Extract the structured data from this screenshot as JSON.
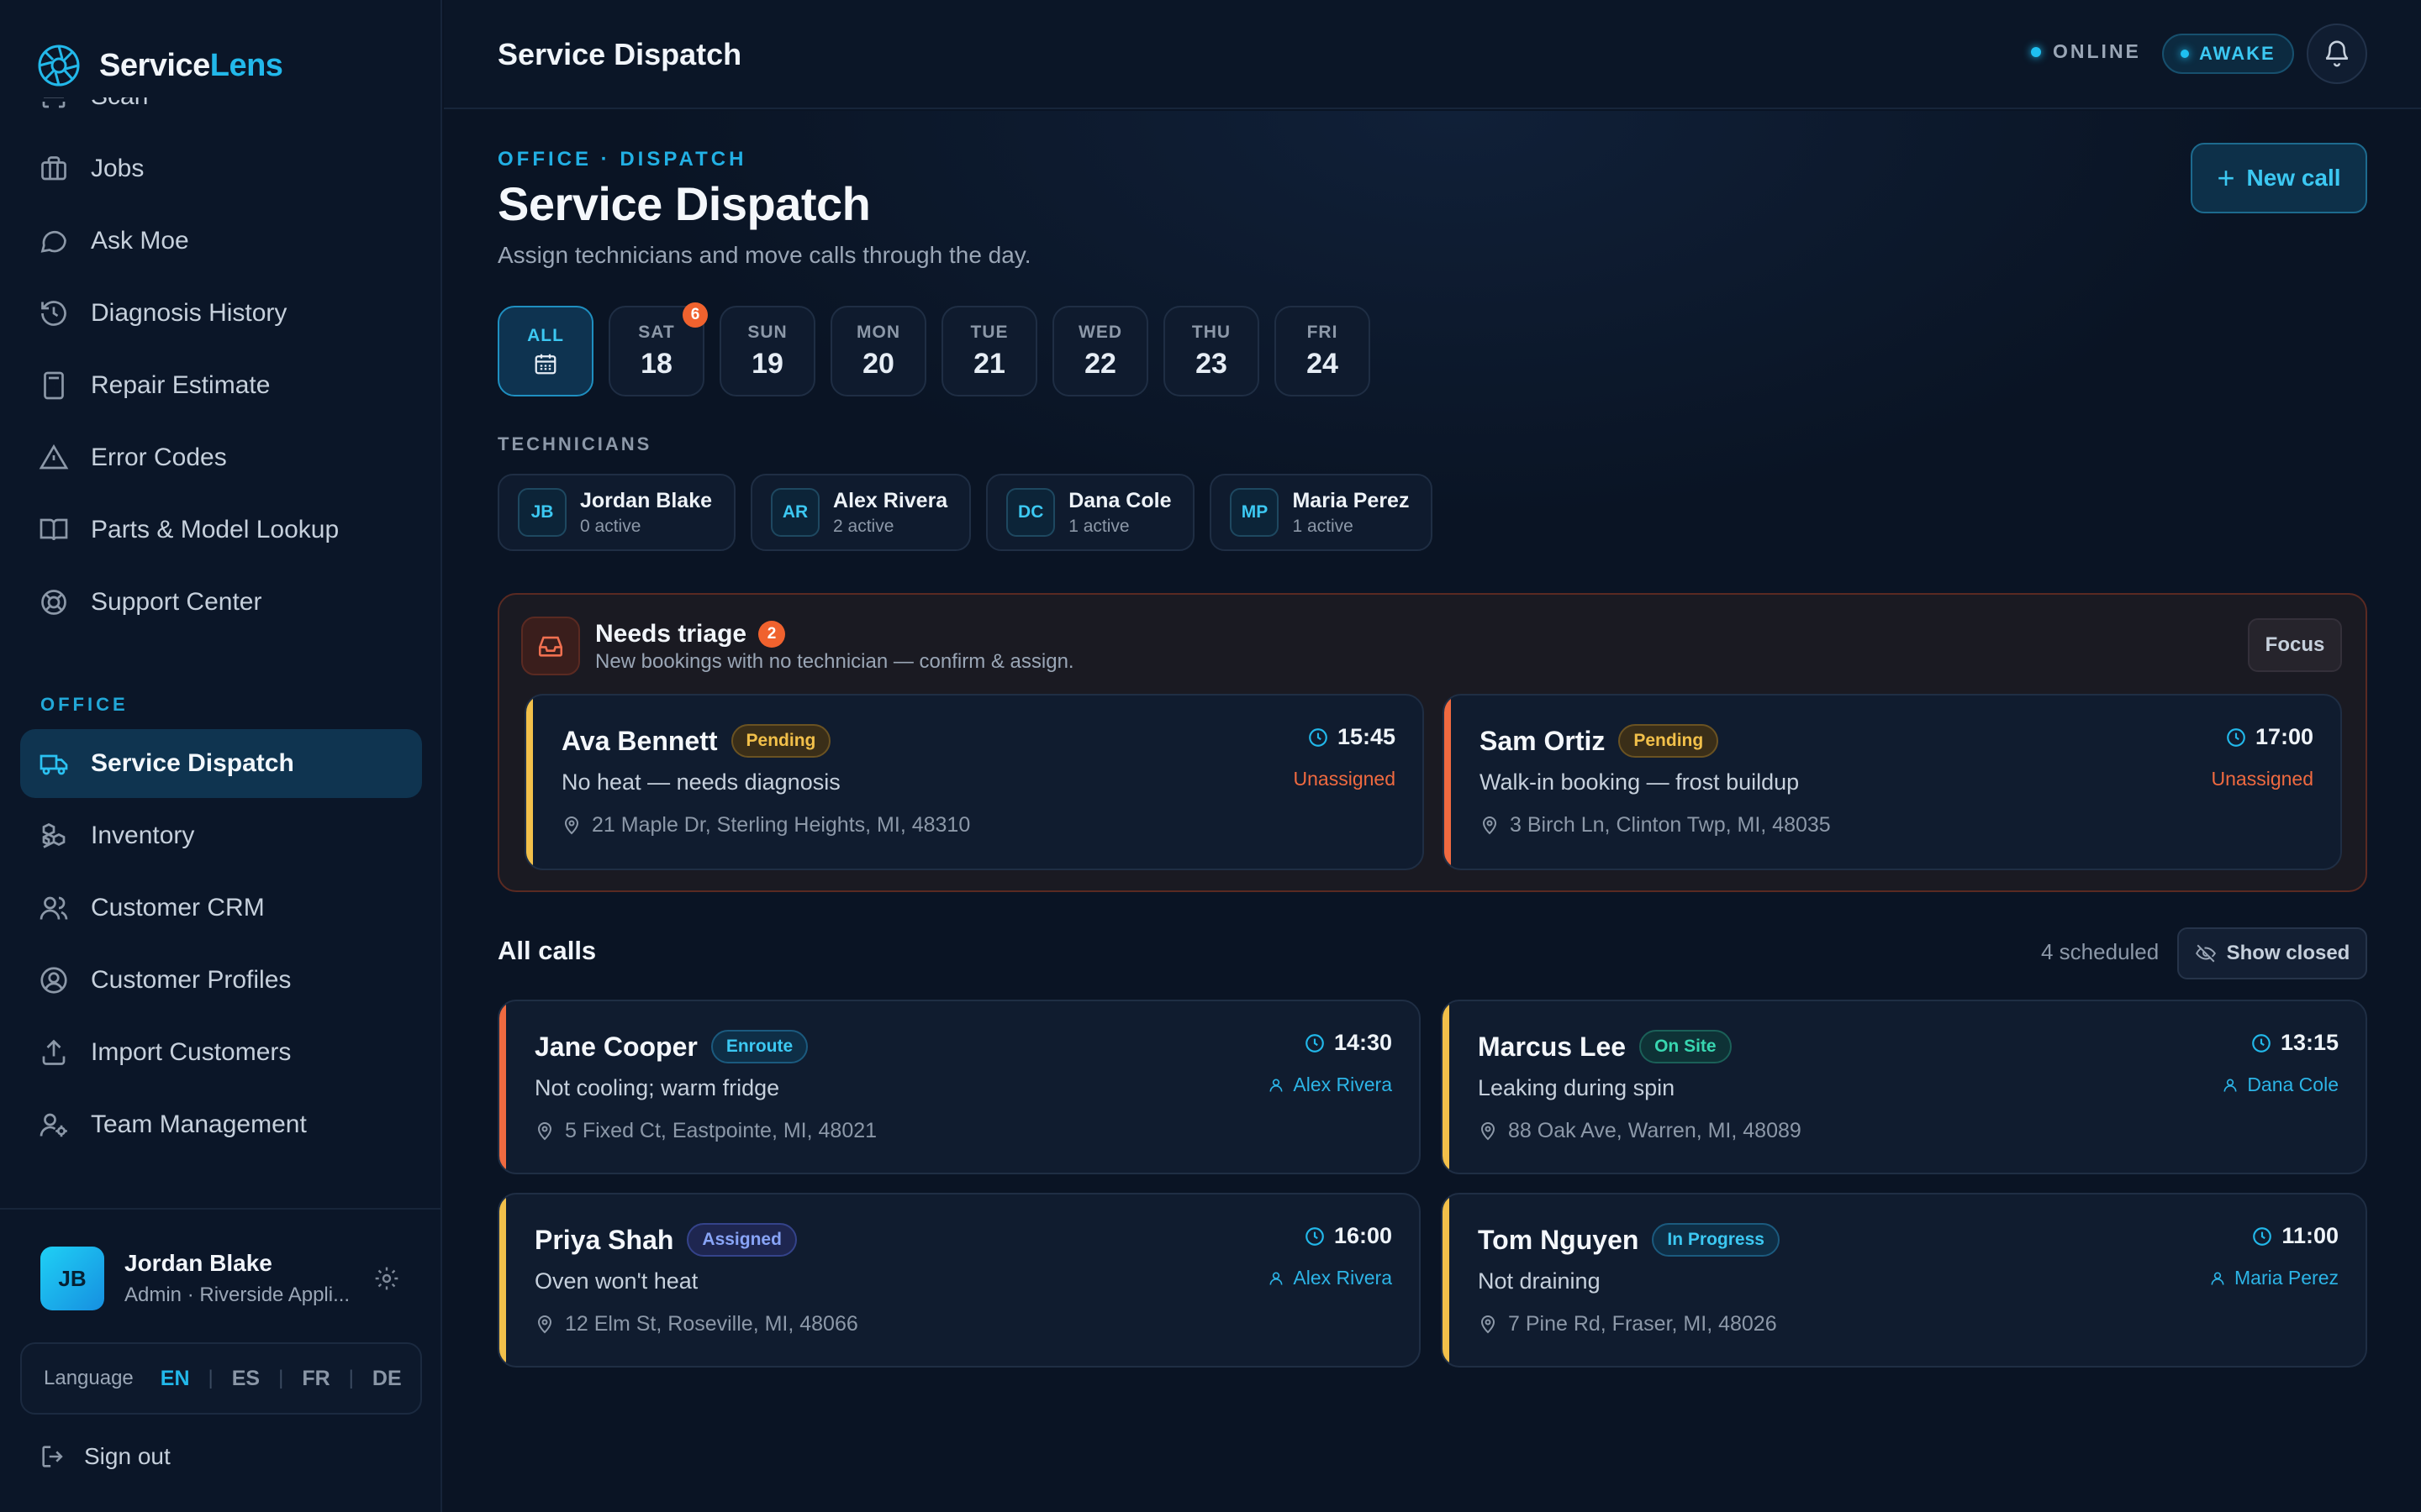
{
  "brand": {
    "name_main": "Service",
    "name_accent": "Lens"
  },
  "sidebar": {
    "items": [
      {
        "label": "Scan",
        "icon": "scan-icon"
      },
      {
        "label": "Jobs",
        "icon": "briefcase-icon"
      },
      {
        "label": "Ask Moe",
        "icon": "chat-bubble-icon"
      },
      {
        "label": "Diagnosis History",
        "icon": "history-icon"
      },
      {
        "label": "Repair Estimate",
        "icon": "calculator-icon"
      },
      {
        "label": "Error Codes",
        "icon": "warning-triangle-icon"
      },
      {
        "label": "Parts & Model Lookup",
        "icon": "open-book-icon"
      },
      {
        "label": "Support Center",
        "icon": "lifebuoy-icon"
      }
    ],
    "office_section": "OFFICE",
    "office_items": [
      {
        "label": "Service Dispatch",
        "icon": "truck-icon",
        "active": true
      },
      {
        "label": "Inventory",
        "icon": "boxes-icon"
      },
      {
        "label": "Customer CRM",
        "icon": "users-icon"
      },
      {
        "label": "Customer Profiles",
        "icon": "user-circle-icon"
      },
      {
        "label": "Import Customers",
        "icon": "upload-icon"
      },
      {
        "label": "Team Management",
        "icon": "user-gear-icon"
      }
    ],
    "user": {
      "initials": "JB",
      "name": "Jordan Blake",
      "role": "Admin · Riverside Appli..."
    },
    "language": {
      "label": "Language",
      "options": [
        "EN",
        "ES",
        "FR",
        "DE"
      ],
      "selected": "EN"
    },
    "sign_out": "Sign out"
  },
  "topbar": {
    "title": "Service Dispatch",
    "online": "ONLINE",
    "awake": "AWAKE"
  },
  "header": {
    "eyebrow": "OFFICE · DISPATCH",
    "title": "Service Dispatch",
    "subtitle": "Assign technicians and move calls through the day.",
    "new_call": "New call"
  },
  "days": {
    "all_label": "ALL",
    "items": [
      {
        "name": "SAT",
        "num": "18",
        "badge": "6"
      },
      {
        "name": "SUN",
        "num": "19"
      },
      {
        "name": "MON",
        "num": "20"
      },
      {
        "name": "TUE",
        "num": "21"
      },
      {
        "name": "WED",
        "num": "22"
      },
      {
        "name": "THU",
        "num": "23"
      },
      {
        "name": "FRI",
        "num": "24"
      }
    ]
  },
  "technicians": {
    "label": "TECHNICIANS",
    "items": [
      {
        "initials": "JB",
        "name": "Jordan Blake",
        "active": "0 active"
      },
      {
        "initials": "AR",
        "name": "Alex Rivera",
        "active": "2 active"
      },
      {
        "initials": "DC",
        "name": "Dana Cole",
        "active": "1 active"
      },
      {
        "initials": "MP",
        "name": "Maria Perez",
        "active": "1 active"
      }
    ]
  },
  "triage": {
    "title": "Needs triage",
    "count": "2",
    "subtitle": "New bookings with no technician — confirm & assign.",
    "focus": "Focus",
    "cards": [
      {
        "name": "Ava Bennett",
        "status": "Pending",
        "desc": "No heat — needs diagnosis",
        "address": "21 Maple Dr, Sterling Heights, MI, 48310",
        "time": "15:45",
        "assignee": "Unassigned",
        "bar": "#f2c04a"
      },
      {
        "name": "Sam Ortiz",
        "status": "Pending",
        "desc": "Walk-in booking — frost buildup",
        "address": "3 Birch Ln, Clinton Twp, MI, 48035",
        "time": "17:00",
        "assignee": "Unassigned",
        "bar": "#f06a40"
      }
    ]
  },
  "calls": {
    "title": "All calls",
    "scheduled": "4 scheduled",
    "show_closed": "Show closed",
    "cards": [
      {
        "name": "Jane Cooper",
        "status": "Enroute",
        "desc": "Not cooling; warm fridge",
        "address": "5 Fixed Ct, Eastpointe, MI, 48021",
        "time": "14:30",
        "assignee": "Alex Rivera",
        "bar": "#f06a40"
      },
      {
        "name": "Marcus Lee",
        "status": "On Site",
        "desc": "Leaking during spin",
        "address": "88 Oak Ave, Warren, MI, 48089",
        "time": "13:15",
        "assignee": "Dana Cole",
        "bar": "#f2c04a"
      },
      {
        "name": "Priya Shah",
        "status": "Assigned",
        "desc": "Oven won't heat",
        "address": "12 Elm St, Roseville, MI, 48066",
        "time": "16:00",
        "assignee": "Alex Rivera",
        "bar": "#f2c04a"
      },
      {
        "name": "Tom Nguyen",
        "status": "In Progress",
        "desc": "Not draining",
        "address": "7 Pine Rd, Fraser, MI, 48026",
        "time": "11:00",
        "assignee": "Maria Perez",
        "bar": "#f2c04a"
      }
    ]
  },
  "colors": {
    "accent": "#22b8ea",
    "alert": "#f0622e",
    "pending": "#f2c04a",
    "background": "#0a1424"
  }
}
